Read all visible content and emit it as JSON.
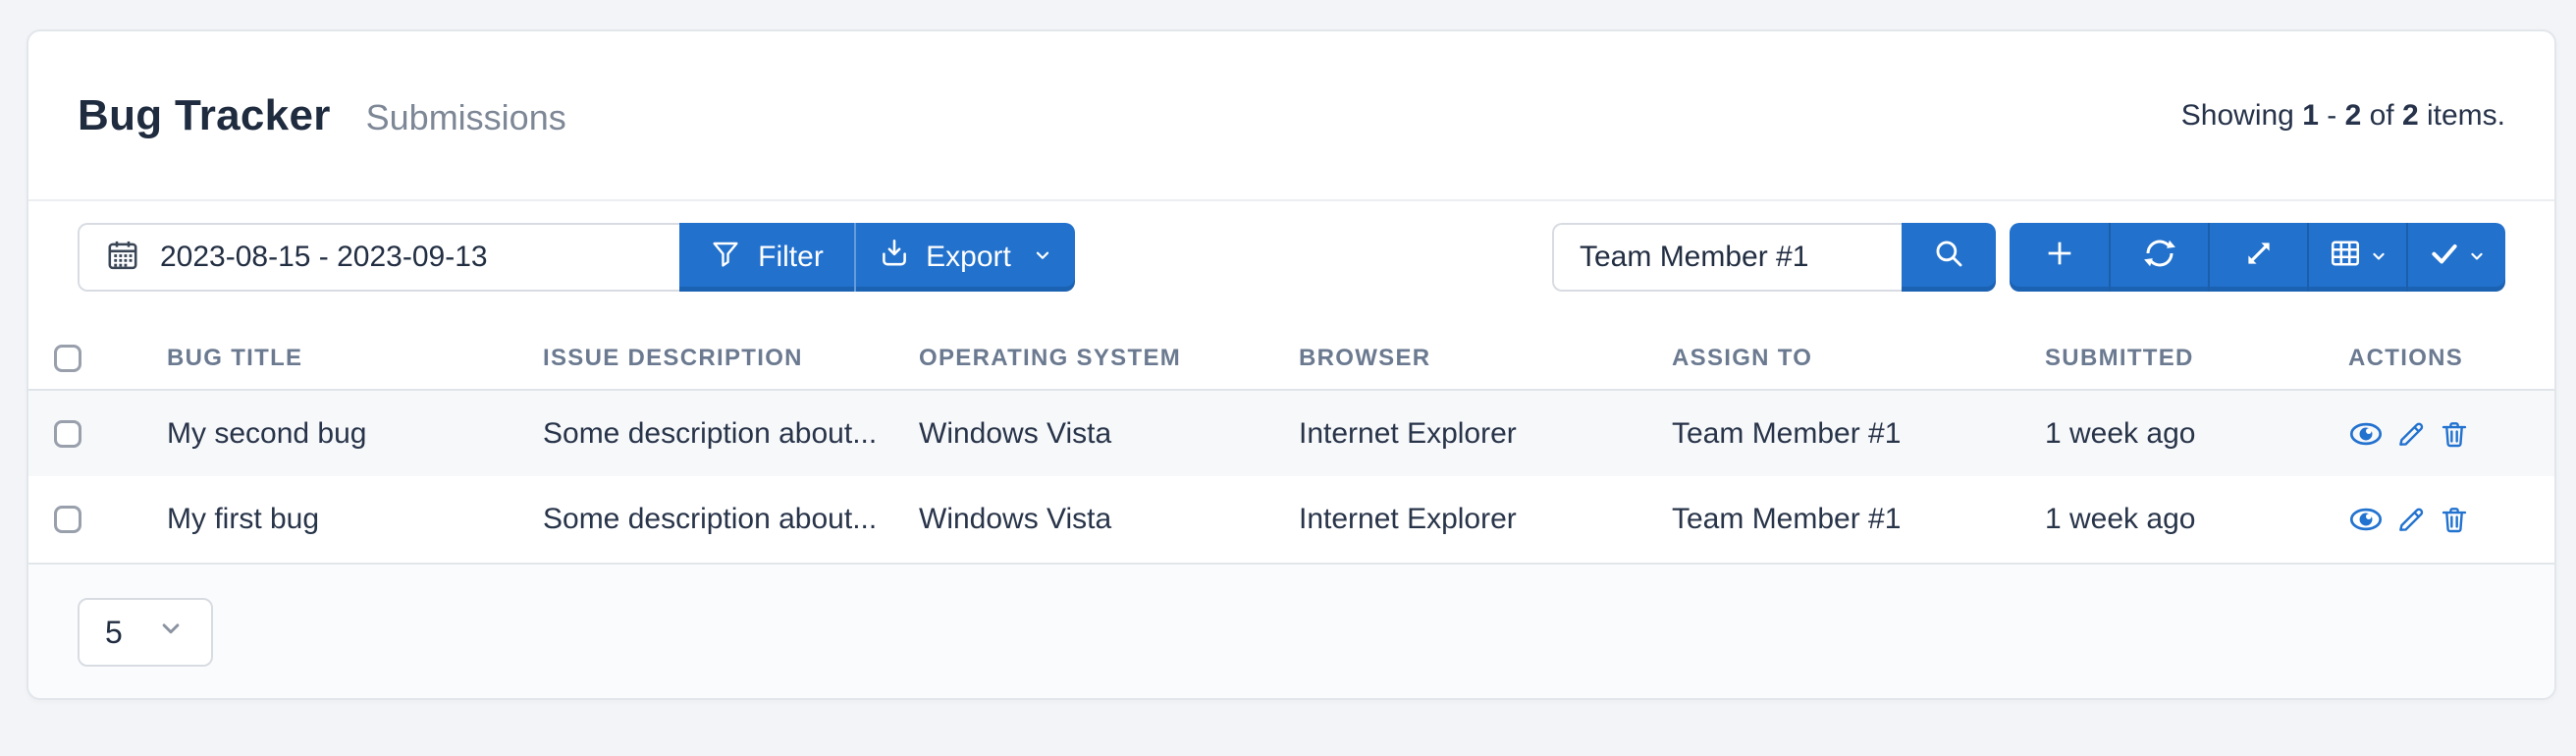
{
  "colors": {
    "primary": "#2171cd",
    "action_icon_blue": "#2272cf",
    "row_stripe": "#f7f8fa"
  },
  "panel": {
    "title": "Bug Tracker",
    "subtitle": "Submissions",
    "summary": {
      "showing": "Showing ",
      "from": "1",
      "dash": " - ",
      "to": "2",
      "of": " of ",
      "total": "2",
      "items": " items."
    }
  },
  "toolbar": {
    "date_range_value": "2023-08-15 - 2023-09-13",
    "date_range_icon": "calendar-icon",
    "filter_label": "Filter",
    "filter_icon": "funnel-icon",
    "export_label": "Export",
    "export_icon": "export-icon",
    "search_value": "Team Member #1",
    "search_icon": "search-icon",
    "action_icons": [
      "plus-icon",
      "refresh-icon",
      "fullscreen-icon",
      "grid-icon",
      "check-icon"
    ]
  },
  "table": {
    "columns": [
      "Bug Title",
      "Issue Description",
      "Operating System",
      "Browser",
      "Assign To",
      "Submitted",
      "Actions"
    ],
    "rows": [
      {
        "title": "My second bug",
        "description": "Some description about...",
        "os": "Windows Vista",
        "browser": "Internet Explorer",
        "assign_to": "Team Member #1",
        "submitted": "1 week ago"
      },
      {
        "title": "My first bug",
        "description": "Some description about...",
        "os": "Windows Vista",
        "browser": "Internet Explorer",
        "assign_to": "Team Member #1",
        "submitted": "1 week ago"
      }
    ],
    "row_action_icons": [
      "eye-icon",
      "pencil-icon",
      "trash-icon"
    ]
  },
  "footer": {
    "page_size": "5"
  }
}
